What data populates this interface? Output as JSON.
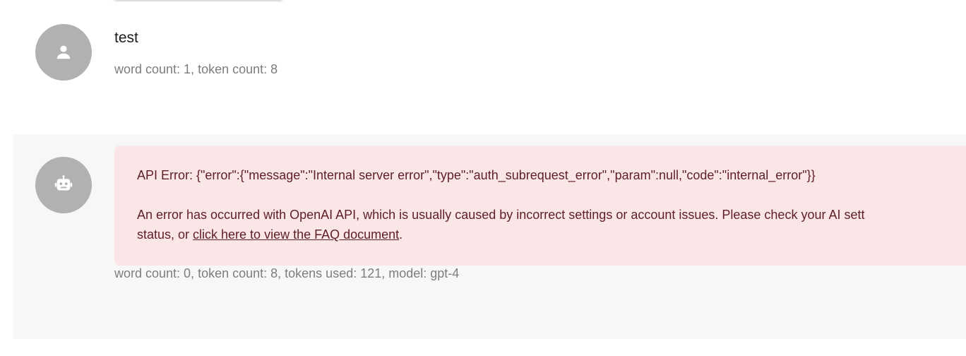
{
  "user_message": {
    "text": "test",
    "meta": "word count: 1, token count: 8",
    "avatar_icon": "person-icon"
  },
  "bot_message": {
    "avatar_icon": "robot-icon",
    "error_title": "API Error: {\"error\":{\"message\":\"Internal server error\",\"type\":\"auth_subrequest_error\",\"param\":null,\"code\":\"internal_error\"}}",
    "error_desc_line1": "An error has occurred with OpenAI API, which is usually caused by incorrect settings or account issues. Please check your AI sett",
    "error_desc_prefix": "status, or ",
    "faq_link": "click here to view the FAQ document",
    "error_desc_suffix": ".",
    "meta": "word count: 0, token count: 8, tokens used: 121, model: gpt-4"
  },
  "colors": {
    "avatar_bg": "#b1b1b1",
    "error_bg": "#fbe6e7",
    "error_text": "#5e1f24",
    "meta_text": "#7d7d7d",
    "bot_row_bg": "#f7f7f7"
  }
}
